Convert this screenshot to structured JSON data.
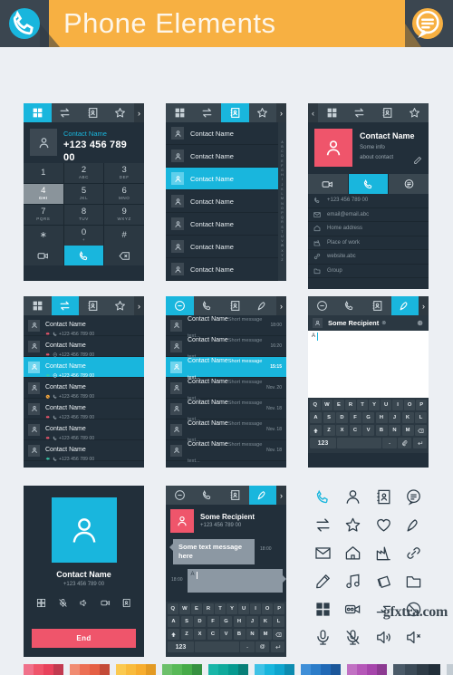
{
  "header": {
    "title": "Phone Elements",
    "left_icon": "phone-icon",
    "right_icon": "message-icon",
    "band_color": "#f7b042",
    "accent_color": "#19b6dd",
    "bar_color": "#3b4650"
  },
  "dialer": {
    "tabs": [
      {
        "icon": "keypad-icon",
        "active": true
      },
      {
        "icon": "transfer-icon",
        "active": false
      },
      {
        "icon": "contacts-icon",
        "active": false
      },
      {
        "icon": "star-icon",
        "active": false
      }
    ],
    "arrow": "›",
    "contact_label": "Contact Name",
    "number": "+123 456 789 00",
    "keys": [
      {
        "digit": "1",
        "letters": "",
        "highlighted": false
      },
      {
        "digit": "2",
        "letters": "ABC",
        "highlighted": false
      },
      {
        "digit": "3",
        "letters": "DEF",
        "highlighted": false
      },
      {
        "digit": "4",
        "letters": "GHI",
        "highlighted": true
      },
      {
        "digit": "5",
        "letters": "JKL",
        "highlighted": false
      },
      {
        "digit": "6",
        "letters": "MNO",
        "highlighted": false
      },
      {
        "digit": "7",
        "letters": "PQRS",
        "highlighted": false
      },
      {
        "digit": "8",
        "letters": "TUV",
        "highlighted": false
      },
      {
        "digit": "9",
        "letters": "WXYZ",
        "highlighted": false
      },
      {
        "digit": "∗",
        "letters": "",
        "highlighted": false
      },
      {
        "digit": "0",
        "letters": "+",
        "highlighted": false
      },
      {
        "digit": "#",
        "letters": "",
        "highlighted": false
      }
    ],
    "bottom_actions": [
      {
        "icon": "video-call-icon",
        "active": false
      },
      {
        "icon": "call-icon",
        "active": true
      },
      {
        "icon": "backspace-icon",
        "active": false
      }
    ]
  },
  "contacts": {
    "tabs": [
      {
        "icon": "keypad-icon",
        "active": false
      },
      {
        "icon": "transfer-icon",
        "active": false
      },
      {
        "icon": "contacts-icon",
        "active": true
      },
      {
        "icon": "star-icon",
        "active": false
      }
    ],
    "arrow": "›",
    "alphabet": "ABCDEFGHIJKLMNOPQRSTUVWXYZ",
    "rows": [
      {
        "name": "Contact Name",
        "selected": false
      },
      {
        "name": "Contact Name",
        "selected": false
      },
      {
        "name": "Contact Name",
        "selected": true
      },
      {
        "name": "Contact Name",
        "selected": false
      },
      {
        "name": "Contact Name",
        "selected": false
      },
      {
        "name": "Contact Name",
        "selected": false
      },
      {
        "name": "Contact Name",
        "selected": false
      }
    ]
  },
  "contact_detail": {
    "back_arrow": "‹",
    "tabs": [
      {
        "icon": "keypad-icon",
        "active": false
      },
      {
        "icon": "transfer-icon",
        "active": false
      },
      {
        "icon": "contacts-icon",
        "active": false
      },
      {
        "icon": "star-icon",
        "active": false
      }
    ],
    "name": "Contact Name",
    "info_line1": "Some info",
    "info_line2": "about contact",
    "edit_icon": "pencil-icon",
    "avatar_color": "#ef556b",
    "actions": [
      {
        "icon": "video-call-icon",
        "active": false
      },
      {
        "icon": "call-icon",
        "active": true
      },
      {
        "icon": "message-icon",
        "active": false
      }
    ],
    "fields": [
      {
        "icon": "phone-icon",
        "value": "+123 456 789 00"
      },
      {
        "icon": "email-icon",
        "value": "email@email.abc"
      },
      {
        "icon": "home-icon",
        "value": "Home address"
      },
      {
        "icon": "work-icon",
        "value": "Place of work"
      },
      {
        "icon": "link-icon",
        "value": "website.abc"
      },
      {
        "icon": "group-icon",
        "value": "Group"
      }
    ]
  },
  "call_log": {
    "tabs": [
      {
        "icon": "keypad-icon",
        "active": false
      },
      {
        "icon": "transfer-icon",
        "active": true
      },
      {
        "icon": "contacts-icon",
        "active": false
      },
      {
        "icon": "star-icon",
        "active": false
      }
    ],
    "arrow": "›",
    "rows": [
      {
        "name": "Contact Name",
        "number": "+123 456 789 00",
        "direction": "outgoing",
        "type": "voice",
        "selected": false
      },
      {
        "name": "Contact Name",
        "number": "+123 456 789 00",
        "direction": "outgoing",
        "type": "message",
        "selected": false
      },
      {
        "name": "Contact Name",
        "number": "+123 456 789 00",
        "direction": "incoming",
        "type": "message",
        "selected": true
      },
      {
        "name": "Contact Name",
        "number": "+123 456 789 00",
        "direction": "missed",
        "type": "voice",
        "selected": false
      },
      {
        "name": "Contact Name",
        "number": "+123 456 789 00",
        "direction": "outgoing",
        "type": "voice",
        "selected": false
      },
      {
        "name": "Contact Name",
        "number": "+123 456 789 00",
        "direction": "outgoing",
        "type": "voice",
        "selected": false
      },
      {
        "name": "Contact Name",
        "number": "+123 456 789 00",
        "direction": "incoming",
        "type": "voice",
        "selected": false
      }
    ],
    "colors": {
      "outgoing": "#ef556b",
      "incoming": "#35c9a8",
      "missed": "#f0a43c"
    }
  },
  "sms_list": {
    "tabs": [
      {
        "icon": "message-icon",
        "active": true
      },
      {
        "icon": "call-icon",
        "active": false
      },
      {
        "icon": "contacts-icon",
        "active": false
      },
      {
        "icon": "compose-icon",
        "active": false
      }
    ],
    "arrow": "›",
    "rows": [
      {
        "name": "Contact Name",
        "preview": "Short message text...",
        "time": "18:00",
        "selected": false
      },
      {
        "name": "Contact Name",
        "preview": "Short message text...",
        "time": "16:20",
        "selected": false
      },
      {
        "name": "Contact Name",
        "preview": "Short message text...",
        "time": "15:15",
        "selected": true
      },
      {
        "name": "Contact Name",
        "preview": "Short message text...",
        "time": "Nov. 20",
        "selected": false
      },
      {
        "name": "Contact Name",
        "preview": "Short message text...",
        "time": "Nov. 18",
        "selected": false
      },
      {
        "name": "Contact Name",
        "preview": "Short message text...",
        "time": "Nov. 18",
        "selected": false
      },
      {
        "name": "Contact Name",
        "preview": "Short message text...",
        "time": "Nov. 18",
        "selected": false
      }
    ]
  },
  "compose": {
    "tabs": [
      {
        "icon": "message-icon",
        "active": false
      },
      {
        "icon": "call-icon",
        "active": false
      },
      {
        "icon": "contacts-icon",
        "active": false
      },
      {
        "icon": "compose-icon",
        "active": true
      }
    ],
    "arrow": "›",
    "recipient": "Some Recipient",
    "remove_icon": "⊗",
    "add_icon": "⊕",
    "typed_text": "A",
    "keyboard": {
      "row1": [
        "Q",
        "W",
        "E",
        "R",
        "T",
        "Y",
        "U",
        "I",
        "O",
        "P"
      ],
      "row2": [
        "A",
        "S",
        "D",
        "F",
        "G",
        "H",
        "J",
        "K",
        "L"
      ],
      "row3": [
        "Z",
        "X",
        "C",
        "V",
        "B",
        "N",
        "M"
      ],
      "shift": "shift-icon",
      "backspace": "backspace-icon",
      "numbers": "123",
      "period": ".",
      "attach": "paperclip-icon",
      "enter": "enter-icon"
    }
  },
  "in_call": {
    "name": "Contact Name",
    "number": "+123 456 789 00",
    "avatar_color": "#19b6dd",
    "tools": [
      "keypad-icon",
      "mute-icon",
      "speaker-icon",
      "video-call-icon",
      "contacts-icon"
    ],
    "end_label": "End",
    "end_color": "#ef556b"
  },
  "chat": {
    "tabs": [
      {
        "icon": "message-icon",
        "active": false
      },
      {
        "icon": "call-icon",
        "active": false
      },
      {
        "icon": "contacts-icon",
        "active": false
      },
      {
        "icon": "compose-icon",
        "active": true
      }
    ],
    "arrow": "›",
    "recipient": "Some Recipient",
    "number": "+123 456 789 00",
    "avatar_color": "#ef556b",
    "incoming_message": "Some text message here",
    "incoming_time": "18:00",
    "outgoing_time": "18:00",
    "typed_text": "A",
    "keyboard": {
      "row1": [
        "Q",
        "W",
        "E",
        "R",
        "T",
        "Y",
        "U",
        "I",
        "O",
        "P"
      ],
      "row2": [
        "A",
        "S",
        "D",
        "F",
        "G",
        "H",
        "J",
        "K",
        "L"
      ],
      "row3": [
        "Z",
        "X",
        "C",
        "V",
        "B",
        "N",
        "M"
      ],
      "numbers": "123",
      "period": ".",
      "at": "@"
    }
  },
  "icon_panel": {
    "icons": [
      {
        "name": "call-icon",
        "accent": true
      },
      {
        "name": "person-icon",
        "accent": false
      },
      {
        "name": "contacts-icon",
        "accent": false
      },
      {
        "name": "message-icon",
        "accent": false
      },
      {
        "name": "transfer-icon",
        "accent": false
      },
      {
        "name": "star-icon",
        "accent": false
      },
      {
        "name": "heart-icon",
        "accent": false
      },
      {
        "name": "compose-icon",
        "accent": false
      },
      {
        "name": "email-icon",
        "accent": false
      },
      {
        "name": "home-icon",
        "accent": false
      },
      {
        "name": "work-icon",
        "accent": false
      },
      {
        "name": "link-icon",
        "accent": false
      },
      {
        "name": "pencil-icon",
        "accent": false
      },
      {
        "name": "music-icon",
        "accent": false
      },
      {
        "name": "photos-icon",
        "accent": false
      },
      {
        "name": "folder-icon",
        "accent": false
      },
      {
        "name": "keypad-icon",
        "accent": false
      },
      {
        "name": "video-call-icon",
        "accent": false
      },
      {
        "name": "call-transfer-icon",
        "accent": false
      },
      {
        "name": "block-icon",
        "accent": false
      },
      {
        "name": "mic-icon",
        "accent": false
      },
      {
        "name": "mic-mute-icon",
        "accent": false
      },
      {
        "name": "speaker-icon",
        "accent": false
      },
      {
        "name": "speaker-mute-icon",
        "accent": false
      }
    ]
  },
  "swatches": [
    [
      "#f0718a",
      "#ef556b",
      "#e8425c",
      "#c23a50"
    ],
    [
      "#f18c72",
      "#ec6f54",
      "#e55f44",
      "#c44a37"
    ],
    [
      "#fbc94f",
      "#f9bb3c",
      "#f7ad2e",
      "#e39a23"
    ],
    [
      "#6cc06a",
      "#58b957",
      "#46ab48",
      "#369140"
    ],
    [
      "#19b6a8",
      "#0faa9c",
      "#069a90",
      "#077f78"
    ],
    [
      "#3fc2e6",
      "#19b6dd",
      "#0fa5ce",
      "#0d8cb0"
    ],
    [
      "#3f8fd8",
      "#2c7dc9",
      "#2069b6",
      "#1b579a"
    ],
    [
      "#c171c3",
      "#b557b8",
      "#a645ab",
      "#8c3a91"
    ],
    [
      "#4a5a68",
      "#3b4a57",
      "#2e3b46",
      "#222f3a"
    ],
    [
      "#c3ccd3",
      "#b0bbc4",
      "#9aa7b0",
      "#8a97a1"
    ]
  ],
  "watermark": "gfxtra.com"
}
